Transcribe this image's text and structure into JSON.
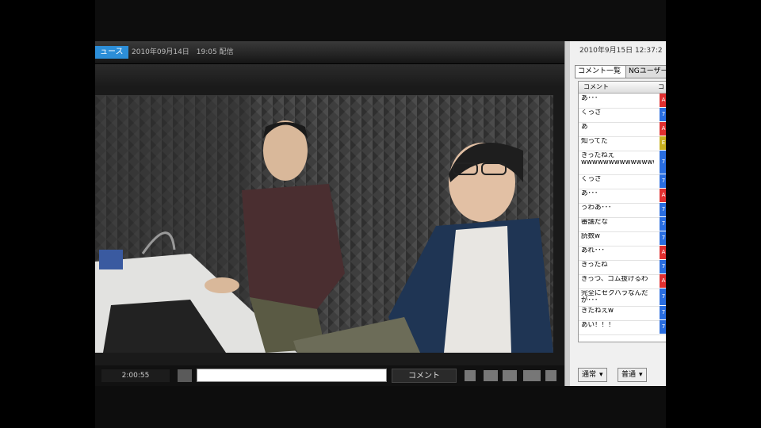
{
  "player": {
    "tag": "ュース",
    "broadcast_date": "2010年09月14日　19:05 配信",
    "time": "2:00:55",
    "comment_placeholder": "",
    "comment_button": "コメント",
    "control_icons": [
      "volume-icon",
      "mute-icon",
      "hd-icon",
      "settings-icon",
      "repeat-icon"
    ]
  },
  "panel": {
    "date": "2010年9月15日 12:37:2",
    "tabs": [
      "コメント一覧",
      "NGユーザー"
    ],
    "list_header": [
      "コメント",
      "コ"
    ],
    "comments": [
      {
        "text": "あ･･･",
        "badge_color": "#e03030",
        "badge": "A"
      },
      {
        "text": "くっさ",
        "badge_color": "#2a6ee0",
        "badge": "7"
      },
      {
        "text": "あ",
        "badge_color": "#e03030",
        "badge": "A"
      },
      {
        "text": "知ってた",
        "badge_color": "#c8b020",
        "badge": "E"
      },
      {
        "text": "きったねえwwwwwwwwwwwwwwwwwwwww",
        "badge_color": "#2a6ee0",
        "badge": "7"
      },
      {
        "text": "くっさ",
        "badge_color": "#2a6ee0",
        "badge": "7"
      },
      {
        "text": "あ･･･",
        "badge_color": "#e03030",
        "badge": "A"
      },
      {
        "text": "うわあ･･･",
        "badge_color": "#2a6ee0",
        "badge": "7"
      },
      {
        "text": "審議だな",
        "badge_color": "#2a6ee0",
        "badge": "7"
      },
      {
        "text": "読数w",
        "badge_color": "#2a6ee0",
        "badge": "7"
      },
      {
        "text": "あれ･･･",
        "badge_color": "#e03030",
        "badge": "A"
      },
      {
        "text": "きったね",
        "badge_color": "#2a6ee0",
        "badge": "7"
      },
      {
        "text": "きっつ、ゴム抜けるわ",
        "badge_color": "#e03030",
        "badge": "A"
      },
      {
        "text": "完全にセクハラなんだが･･･",
        "badge_color": "#2a6ee0",
        "badge": "7"
      },
      {
        "text": "きたねえw",
        "badge_color": "#2a6ee0",
        "badge": "7"
      },
      {
        "text": "あい！！！",
        "badge_color": "#2a6ee0",
        "badge": "7"
      }
    ],
    "select_mode": "通常",
    "select_size": "普通",
    "dropdown_arrow": "▾"
  }
}
